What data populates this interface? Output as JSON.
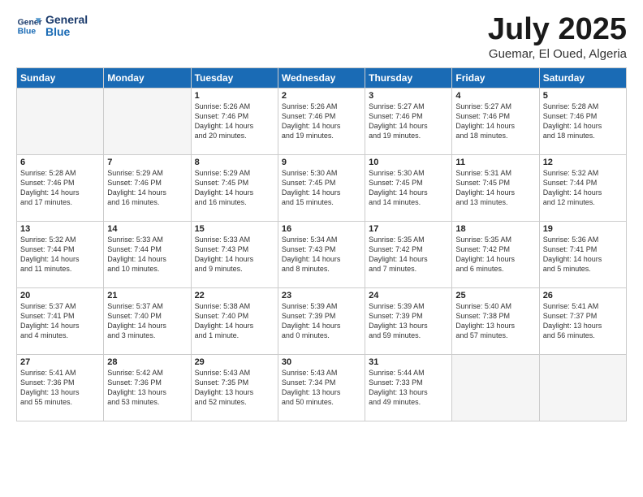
{
  "header": {
    "logo_line1": "General",
    "logo_line2": "Blue",
    "month": "July 2025",
    "location": "Guemar, El Oued, Algeria"
  },
  "weekdays": [
    "Sunday",
    "Monday",
    "Tuesday",
    "Wednesday",
    "Thursday",
    "Friday",
    "Saturday"
  ],
  "weeks": [
    [
      {
        "day": "",
        "info": ""
      },
      {
        "day": "",
        "info": ""
      },
      {
        "day": "1",
        "info": "Sunrise: 5:26 AM\nSunset: 7:46 PM\nDaylight: 14 hours\nand 20 minutes."
      },
      {
        "day": "2",
        "info": "Sunrise: 5:26 AM\nSunset: 7:46 PM\nDaylight: 14 hours\nand 19 minutes."
      },
      {
        "day": "3",
        "info": "Sunrise: 5:27 AM\nSunset: 7:46 PM\nDaylight: 14 hours\nand 19 minutes."
      },
      {
        "day": "4",
        "info": "Sunrise: 5:27 AM\nSunset: 7:46 PM\nDaylight: 14 hours\nand 18 minutes."
      },
      {
        "day": "5",
        "info": "Sunrise: 5:28 AM\nSunset: 7:46 PM\nDaylight: 14 hours\nand 18 minutes."
      }
    ],
    [
      {
        "day": "6",
        "info": "Sunrise: 5:28 AM\nSunset: 7:46 PM\nDaylight: 14 hours\nand 17 minutes."
      },
      {
        "day": "7",
        "info": "Sunrise: 5:29 AM\nSunset: 7:46 PM\nDaylight: 14 hours\nand 16 minutes."
      },
      {
        "day": "8",
        "info": "Sunrise: 5:29 AM\nSunset: 7:45 PM\nDaylight: 14 hours\nand 16 minutes."
      },
      {
        "day": "9",
        "info": "Sunrise: 5:30 AM\nSunset: 7:45 PM\nDaylight: 14 hours\nand 15 minutes."
      },
      {
        "day": "10",
        "info": "Sunrise: 5:30 AM\nSunset: 7:45 PM\nDaylight: 14 hours\nand 14 minutes."
      },
      {
        "day": "11",
        "info": "Sunrise: 5:31 AM\nSunset: 7:45 PM\nDaylight: 14 hours\nand 13 minutes."
      },
      {
        "day": "12",
        "info": "Sunrise: 5:32 AM\nSunset: 7:44 PM\nDaylight: 14 hours\nand 12 minutes."
      }
    ],
    [
      {
        "day": "13",
        "info": "Sunrise: 5:32 AM\nSunset: 7:44 PM\nDaylight: 14 hours\nand 11 minutes."
      },
      {
        "day": "14",
        "info": "Sunrise: 5:33 AM\nSunset: 7:44 PM\nDaylight: 14 hours\nand 10 minutes."
      },
      {
        "day": "15",
        "info": "Sunrise: 5:33 AM\nSunset: 7:43 PM\nDaylight: 14 hours\nand 9 minutes."
      },
      {
        "day": "16",
        "info": "Sunrise: 5:34 AM\nSunset: 7:43 PM\nDaylight: 14 hours\nand 8 minutes."
      },
      {
        "day": "17",
        "info": "Sunrise: 5:35 AM\nSunset: 7:42 PM\nDaylight: 14 hours\nand 7 minutes."
      },
      {
        "day": "18",
        "info": "Sunrise: 5:35 AM\nSunset: 7:42 PM\nDaylight: 14 hours\nand 6 minutes."
      },
      {
        "day": "19",
        "info": "Sunrise: 5:36 AM\nSunset: 7:41 PM\nDaylight: 14 hours\nand 5 minutes."
      }
    ],
    [
      {
        "day": "20",
        "info": "Sunrise: 5:37 AM\nSunset: 7:41 PM\nDaylight: 14 hours\nand 4 minutes."
      },
      {
        "day": "21",
        "info": "Sunrise: 5:37 AM\nSunset: 7:40 PM\nDaylight: 14 hours\nand 3 minutes."
      },
      {
        "day": "22",
        "info": "Sunrise: 5:38 AM\nSunset: 7:40 PM\nDaylight: 14 hours\nand 1 minute."
      },
      {
        "day": "23",
        "info": "Sunrise: 5:39 AM\nSunset: 7:39 PM\nDaylight: 14 hours\nand 0 minutes."
      },
      {
        "day": "24",
        "info": "Sunrise: 5:39 AM\nSunset: 7:39 PM\nDaylight: 13 hours\nand 59 minutes."
      },
      {
        "day": "25",
        "info": "Sunrise: 5:40 AM\nSunset: 7:38 PM\nDaylight: 13 hours\nand 57 minutes."
      },
      {
        "day": "26",
        "info": "Sunrise: 5:41 AM\nSunset: 7:37 PM\nDaylight: 13 hours\nand 56 minutes."
      }
    ],
    [
      {
        "day": "27",
        "info": "Sunrise: 5:41 AM\nSunset: 7:36 PM\nDaylight: 13 hours\nand 55 minutes."
      },
      {
        "day": "28",
        "info": "Sunrise: 5:42 AM\nSunset: 7:36 PM\nDaylight: 13 hours\nand 53 minutes."
      },
      {
        "day": "29",
        "info": "Sunrise: 5:43 AM\nSunset: 7:35 PM\nDaylight: 13 hours\nand 52 minutes."
      },
      {
        "day": "30",
        "info": "Sunrise: 5:43 AM\nSunset: 7:34 PM\nDaylight: 13 hours\nand 50 minutes."
      },
      {
        "day": "31",
        "info": "Sunrise: 5:44 AM\nSunset: 7:33 PM\nDaylight: 13 hours\nand 49 minutes."
      },
      {
        "day": "",
        "info": ""
      },
      {
        "day": "",
        "info": ""
      }
    ]
  ]
}
